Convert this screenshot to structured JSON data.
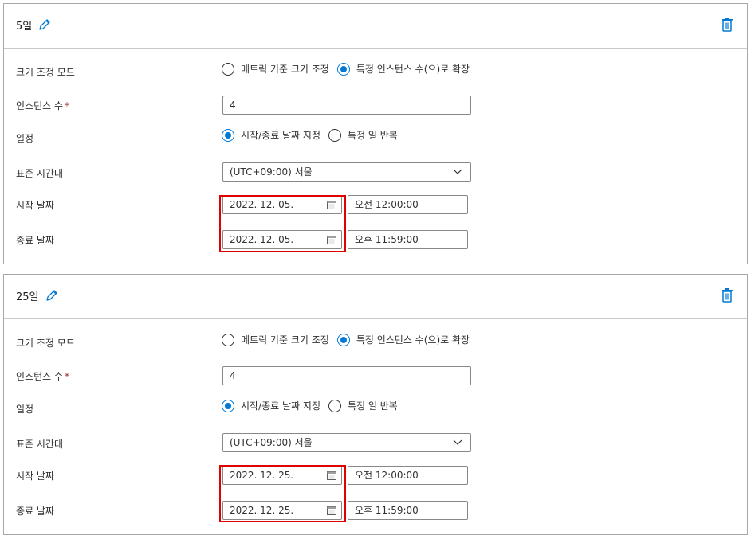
{
  "form_labels": {
    "scale_mode": "크기 조정 모드",
    "instance_count": "인스턴스 수",
    "required_mark": "*",
    "schedule": "일정",
    "timezone": "표준 시간대",
    "start_date": "시작 날짜",
    "end_date": "종료 날짜"
  },
  "radio_options": {
    "scale_mode": [
      "메트릭 기준 크기 조정",
      "특정 인스턴스 수(으)로 확장"
    ],
    "schedule": [
      "시작/종료 날짜 지정",
      "특정 일 반복"
    ]
  },
  "colors": {
    "accent": "#0078d4",
    "highlight": "#e00000",
    "required": "#a4262c"
  },
  "icons": {
    "edit": "pencil-icon",
    "delete": "trash-icon",
    "calendar": "calendar-icon",
    "dropdown": "chevron-down-icon"
  },
  "conditions": [
    {
      "title": "5일",
      "scale_mode_selected": 1,
      "instance_count": "4",
      "schedule_selected": 0,
      "timezone": "(UTC+09:00) 서울",
      "start_date": "2022. 12. 05.",
      "start_time": "오전 12:00:00",
      "end_date": "2022. 12. 05.",
      "end_time": "오후 11:59:00"
    },
    {
      "title": "25일",
      "scale_mode_selected": 1,
      "instance_count": "4",
      "schedule_selected": 0,
      "timezone": "(UTC+09:00) 서울",
      "start_date": "2022. 12. 25.",
      "start_time": "오전 12:00:00",
      "end_date": "2022. 12. 25.",
      "end_time": "오후 11:59:00"
    }
  ]
}
